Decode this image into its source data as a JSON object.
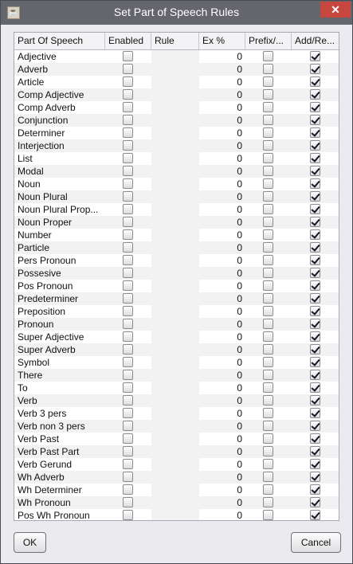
{
  "window": {
    "title": "Set Part of Speech Rules",
    "close_label": "✕"
  },
  "table": {
    "columns": [
      "Part Of Speech",
      "Enabled",
      "Rule",
      "Ex %",
      "Prefix/...",
      "Add/Re..."
    ],
    "rows": [
      {
        "name": "Adjective",
        "enabled": false,
        "rule": "",
        "ex": "0",
        "prefix": false,
        "add": true
      },
      {
        "name": "Adverb",
        "enabled": false,
        "rule": "",
        "ex": "0",
        "prefix": false,
        "add": true
      },
      {
        "name": "Article",
        "enabled": false,
        "rule": "",
        "ex": "0",
        "prefix": false,
        "add": true
      },
      {
        "name": "Comp Adjective",
        "enabled": false,
        "rule": "",
        "ex": "0",
        "prefix": false,
        "add": true
      },
      {
        "name": "Comp Adverb",
        "enabled": false,
        "rule": "",
        "ex": "0",
        "prefix": false,
        "add": true
      },
      {
        "name": "Conjunction",
        "enabled": false,
        "rule": "",
        "ex": "0",
        "prefix": false,
        "add": true
      },
      {
        "name": "Determiner",
        "enabled": false,
        "rule": "",
        "ex": "0",
        "prefix": false,
        "add": true
      },
      {
        "name": "Interjection",
        "enabled": false,
        "rule": "",
        "ex": "0",
        "prefix": false,
        "add": true
      },
      {
        "name": "List",
        "enabled": false,
        "rule": "",
        "ex": "0",
        "prefix": false,
        "add": true
      },
      {
        "name": "Modal",
        "enabled": false,
        "rule": "",
        "ex": "0",
        "prefix": false,
        "add": true
      },
      {
        "name": "Noun",
        "enabled": false,
        "rule": "",
        "ex": "0",
        "prefix": false,
        "add": true
      },
      {
        "name": "Noun Plural",
        "enabled": false,
        "rule": "",
        "ex": "0",
        "prefix": false,
        "add": true
      },
      {
        "name": "Noun Plural Prop...",
        "enabled": false,
        "rule": "",
        "ex": "0",
        "prefix": false,
        "add": true
      },
      {
        "name": "Noun Proper",
        "enabled": false,
        "rule": "",
        "ex": "0",
        "prefix": false,
        "add": true
      },
      {
        "name": "Number",
        "enabled": false,
        "rule": "",
        "ex": "0",
        "prefix": false,
        "add": true
      },
      {
        "name": "Particle",
        "enabled": false,
        "rule": "",
        "ex": "0",
        "prefix": false,
        "add": true
      },
      {
        "name": "Pers Pronoun",
        "enabled": false,
        "rule": "",
        "ex": "0",
        "prefix": false,
        "add": true
      },
      {
        "name": "Possesive",
        "enabled": false,
        "rule": "",
        "ex": "0",
        "prefix": false,
        "add": true
      },
      {
        "name": "Pos Pronoun",
        "enabled": false,
        "rule": "",
        "ex": "0",
        "prefix": false,
        "add": true
      },
      {
        "name": "Predeterminer",
        "enabled": false,
        "rule": "",
        "ex": "0",
        "prefix": false,
        "add": true
      },
      {
        "name": "Preposition",
        "enabled": false,
        "rule": "",
        "ex": "0",
        "prefix": false,
        "add": true
      },
      {
        "name": "Pronoun",
        "enabled": false,
        "rule": "",
        "ex": "0",
        "prefix": false,
        "add": true
      },
      {
        "name": "Super Adjective",
        "enabled": false,
        "rule": "",
        "ex": "0",
        "prefix": false,
        "add": true
      },
      {
        "name": "Super Adverb",
        "enabled": false,
        "rule": "",
        "ex": "0",
        "prefix": false,
        "add": true
      },
      {
        "name": "Symbol",
        "enabled": false,
        "rule": "",
        "ex": "0",
        "prefix": false,
        "add": true
      },
      {
        "name": "There",
        "enabled": false,
        "rule": "",
        "ex": "0",
        "prefix": false,
        "add": true
      },
      {
        "name": "To",
        "enabled": false,
        "rule": "",
        "ex": "0",
        "prefix": false,
        "add": true
      },
      {
        "name": "Verb",
        "enabled": false,
        "rule": "",
        "ex": "0",
        "prefix": false,
        "add": true
      },
      {
        "name": "Verb 3 pers",
        "enabled": false,
        "rule": "",
        "ex": "0",
        "prefix": false,
        "add": true
      },
      {
        "name": "Verb non 3 pers",
        "enabled": false,
        "rule": "",
        "ex": "0",
        "prefix": false,
        "add": true
      },
      {
        "name": "Verb Past",
        "enabled": false,
        "rule": "",
        "ex": "0",
        "prefix": false,
        "add": true
      },
      {
        "name": "Verb Past Part",
        "enabled": false,
        "rule": "",
        "ex": "0",
        "prefix": false,
        "add": true
      },
      {
        "name": "Verb Gerund",
        "enabled": false,
        "rule": "",
        "ex": "0",
        "prefix": false,
        "add": true
      },
      {
        "name": "Wh Adverb",
        "enabled": false,
        "rule": "",
        "ex": "0",
        "prefix": false,
        "add": true
      },
      {
        "name": "Wh Determiner",
        "enabled": false,
        "rule": "",
        "ex": "0",
        "prefix": false,
        "add": true
      },
      {
        "name": "Wh Pronoun",
        "enabled": false,
        "rule": "",
        "ex": "0",
        "prefix": false,
        "add": true
      },
      {
        "name": "Pos Wh Pronoun",
        "enabled": false,
        "rule": "",
        "ex": "0",
        "prefix": false,
        "add": true
      }
    ]
  },
  "buttons": {
    "ok": "OK",
    "cancel": "Cancel"
  },
  "colors": {
    "titlebar": "#65656d",
    "close": "#c7463e",
    "dialog": "#ebeaee"
  }
}
